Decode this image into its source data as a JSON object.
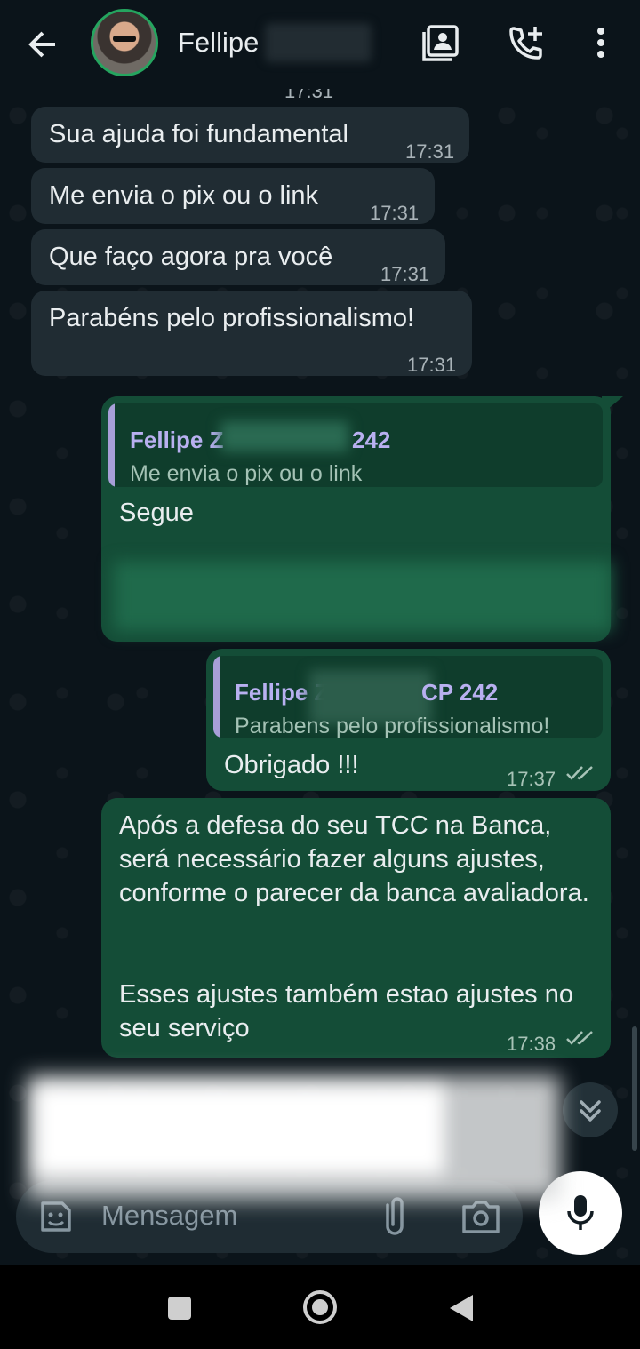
{
  "header": {
    "contact_name": "Fellipe",
    "icons": [
      "back-arrow-icon",
      "contact-card-icon",
      "add-call-icon",
      "more-vert-icon"
    ]
  },
  "messages": {
    "partial_time": "17:31",
    "m1": {
      "text": "Sua ajuda foi fundamental",
      "time": "17:31"
    },
    "m2": {
      "text": "Me envia o pix ou o link",
      "time": "17:31"
    },
    "m3": {
      "text": "Que faço agora pra você",
      "time": "17:31"
    },
    "m4": {
      "text": "Parabéns pelo profissionalismo!",
      "time": "17:31"
    },
    "m5": {
      "quote_name_start": "Fellipe Z",
      "quote_name_end": "242",
      "quote_text": "Me envia o pix ou o link",
      "text": "Segue"
    },
    "m6": {
      "quote_name": "Fellipe Z",
      "quote_name_end": "CP 242",
      "quote_text": "Parabens pelo profissionalismo!",
      "text": "Obrigado !!!",
      "time": "17:37"
    },
    "m7": {
      "text_p1": "Após a defesa do seu TCC na Banca, será necessário fazer alguns ajustes, conforme o parecer da banca avaliadora.",
      "text_p2": "Esses ajustes também estao ajustes no seu serviço",
      "time": "17:38"
    }
  },
  "composer": {
    "placeholder": "Mensagem",
    "icons": [
      "sticker-icon",
      "attach-icon",
      "camera-icon",
      "mic-icon",
      "scroll-down-icon"
    ]
  },
  "navbar": {
    "icons": [
      "recents-icon",
      "home-icon",
      "back-icon"
    ]
  },
  "colors": {
    "background": "#0b141a",
    "incoming_bubble": "#202c33",
    "outgoing_bubble": "#144d37",
    "accent": "#25a55f"
  }
}
